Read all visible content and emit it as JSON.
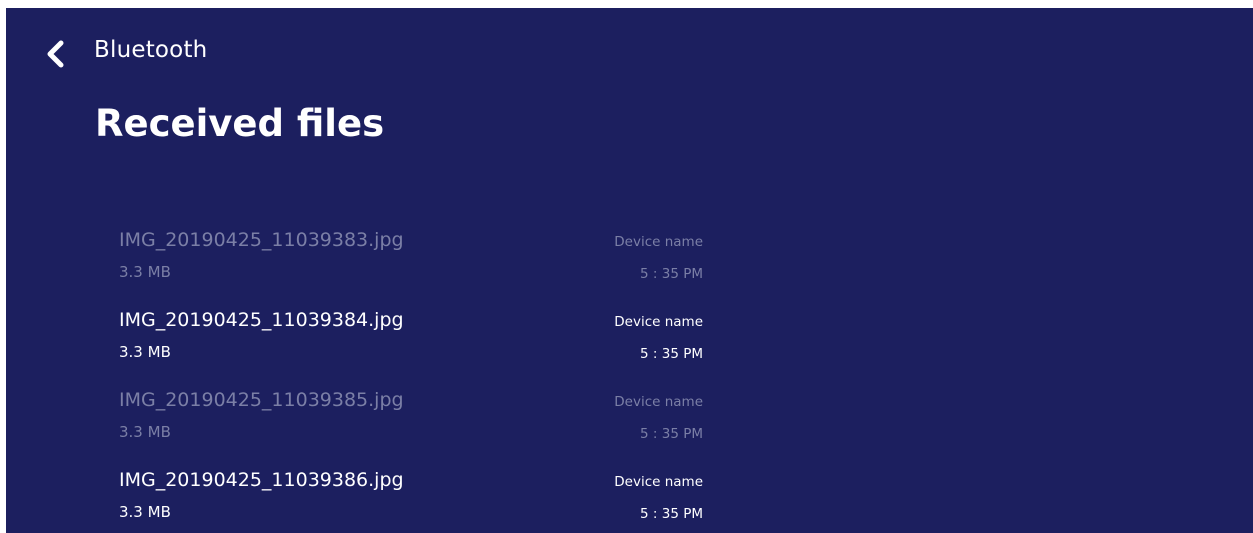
{
  "header": {
    "back_label": "Bluetooth",
    "back_icon": "chevron-left-icon",
    "title": "Received files"
  },
  "files": [
    {
      "name": "IMG_20190425_11039383.jpg",
      "size": "3.3 MB",
      "device": "Device name",
      "time": "5 : 35 PM",
      "dimmed": true
    },
    {
      "name": "IMG_20190425_11039384.jpg",
      "size": "3.3 MB",
      "device": "Device name",
      "time": "5 : 35 PM",
      "dimmed": false
    },
    {
      "name": "IMG_20190425_11039385.jpg",
      "size": "3.3 MB",
      "device": "Device name",
      "time": "5 : 35 PM",
      "dimmed": true
    },
    {
      "name": "IMG_20190425_11039386.jpg",
      "size": "3.3 MB",
      "device": "Device name",
      "time": "5 : 35 PM",
      "dimmed": false
    }
  ],
  "colors": {
    "background": "#1c1f5f",
    "text": "#ffffff",
    "dimmed_text": "#7b7fa6"
  }
}
